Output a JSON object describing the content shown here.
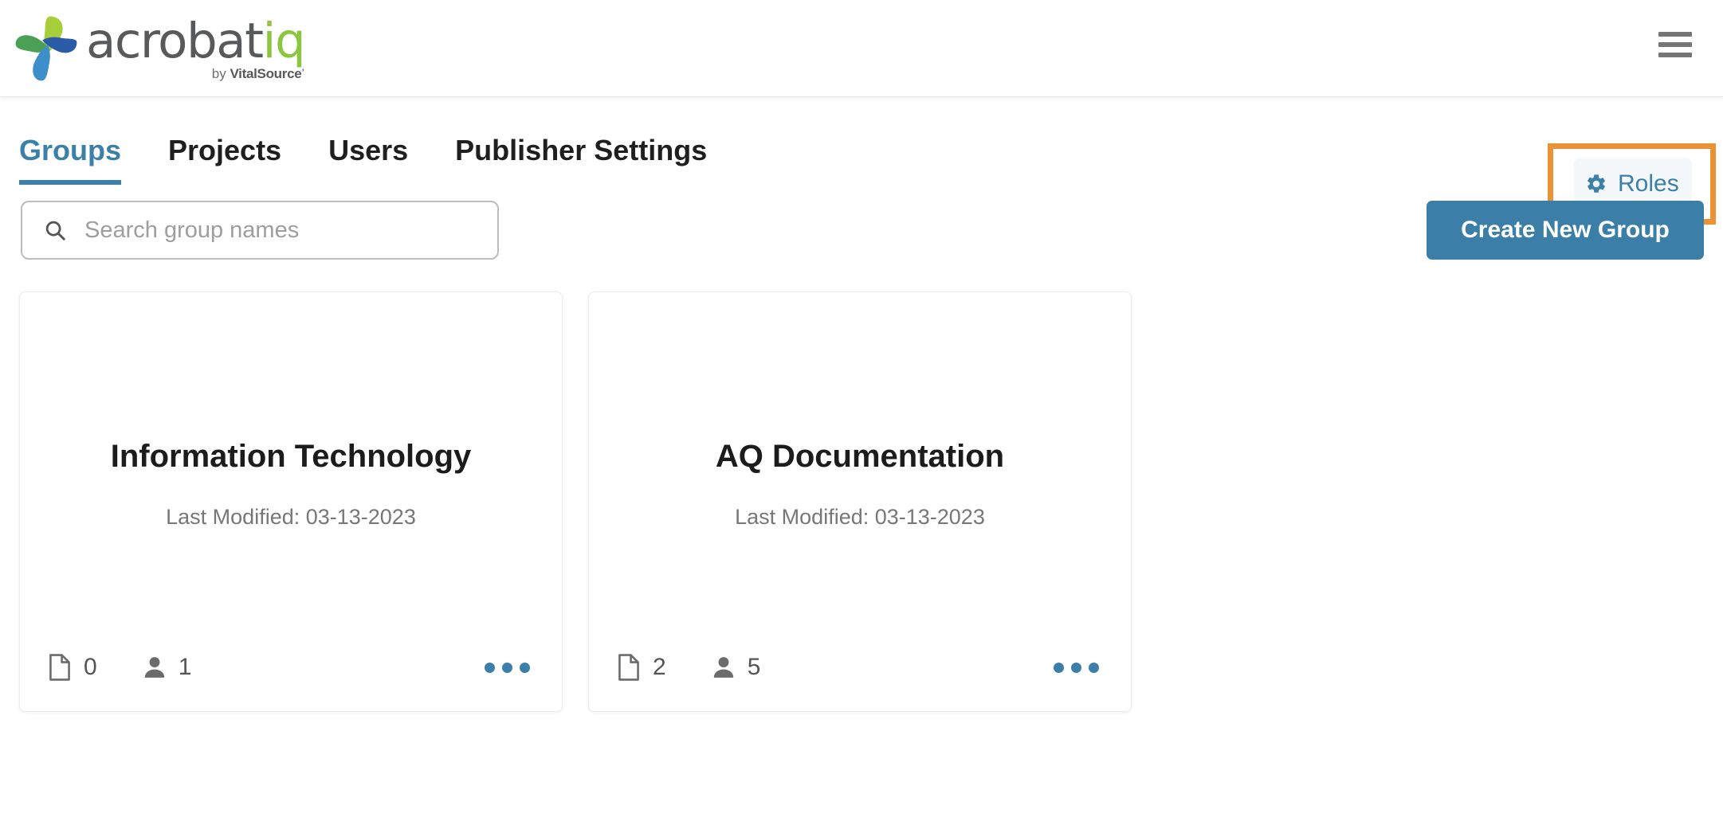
{
  "header": {
    "brand": {
      "wordmark_main": "acrobat",
      "wordmark_accent": "iq",
      "byline_prefix": "by ",
      "byline_brand": "VitalSource",
      "byline_suffix": "’",
      "logo_icon": "acrobatiq-pinwheel-logo",
      "logo_colors": {
        "top_petal": "#a6ce39",
        "left_petal": "#4ba055",
        "right_petal": "#2b5ca8",
        "bottom_petal": "#3d8ec9"
      }
    },
    "menu_icon": "hamburger-menu-icon"
  },
  "nav": {
    "tabs": [
      {
        "label": "Groups",
        "active": true
      },
      {
        "label": "Projects",
        "active": false
      },
      {
        "label": "Users",
        "active": false
      },
      {
        "label": "Publisher Settings",
        "active": false
      }
    ],
    "active_color": "#3c7fa8",
    "roles": {
      "label": "Roles",
      "icon": "gear-icon",
      "highlight_color": "#eb9136",
      "background": "#f4f8fb",
      "text_color": "#3c7fa8"
    }
  },
  "toolbar": {
    "search": {
      "placeholder": "Search group names",
      "value": "",
      "icon": "search-icon"
    },
    "create_button": {
      "label": "Create New Group",
      "color": "#3b7ea8"
    }
  },
  "groups": [
    {
      "title": "Information Technology",
      "modified": "Last Modified: 03-13-2023",
      "documents": "0",
      "members": "1",
      "menu_icon": "ellipsis-menu-icon"
    },
    {
      "title": "AQ Documentation",
      "modified": "Last Modified: 03-13-2023",
      "documents": "2",
      "members": "5",
      "menu_icon": "ellipsis-menu-icon"
    }
  ]
}
